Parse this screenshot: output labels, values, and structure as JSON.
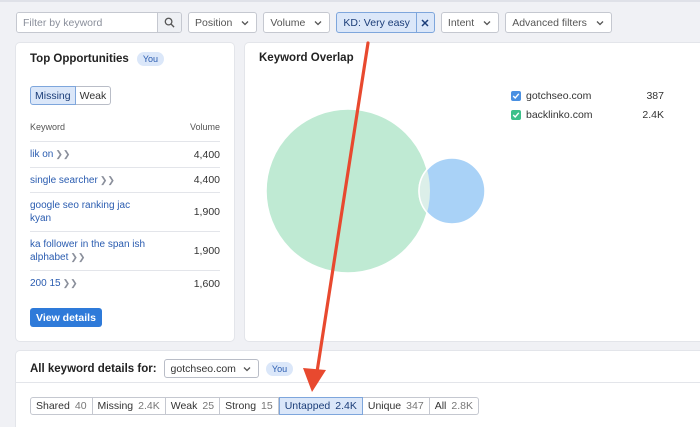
{
  "filters": {
    "search_placeholder": "Filter by keyword",
    "position_label": "Position",
    "volume_label": "Volume",
    "kd_label": "KD: Very easy",
    "intent_label": "Intent",
    "advanced_label": "Advanced filters"
  },
  "top_opportunities": {
    "title": "Top Opportunities",
    "badge": "You",
    "toggle": [
      "Missing",
      "Weak"
    ],
    "col_keyword": "Keyword",
    "col_volume": "Volume",
    "rows": [
      {
        "keyword": "lik on",
        "volume": "4,400"
      },
      {
        "keyword": "single searcher",
        "volume": "4,400"
      },
      {
        "keyword": "google seo ranking jac kyan",
        "volume": "1,900"
      },
      {
        "keyword": "ka follower in the span ish alphabet",
        "volume": "1,900"
      },
      {
        "keyword": "200 15",
        "volume": "1,600"
      }
    ],
    "view_details": "View details"
  },
  "keyword_overlap": {
    "title": "Keyword Overlap",
    "legend": [
      {
        "domain": "gotchseo.com",
        "count": "387",
        "color": "#4a90e2"
      },
      {
        "domain": "backlinko.com",
        "count": "2.4K",
        "color": "#3cc08a"
      }
    ],
    "venn": {
      "large_color": "#bfead3",
      "small_color": "#a9d2f7",
      "overlap_color": "#dcefe9",
      "stroke": "#ffffff"
    }
  },
  "details": {
    "title": "All keyword details for:",
    "domain": "gotchseo.com",
    "badge": "You",
    "tabs": [
      {
        "label": "Shared",
        "count": "40"
      },
      {
        "label": "Missing",
        "count": "2.4K"
      },
      {
        "label": "Weak",
        "count": "25"
      },
      {
        "label": "Strong",
        "count": "15"
      },
      {
        "label": "Untapped",
        "count": "2.4K",
        "active": true
      },
      {
        "label": "Unique",
        "count": "347"
      },
      {
        "label": "All",
        "count": "2.8K"
      }
    ]
  },
  "annotation": {
    "arrow_color": "#e8492f"
  }
}
